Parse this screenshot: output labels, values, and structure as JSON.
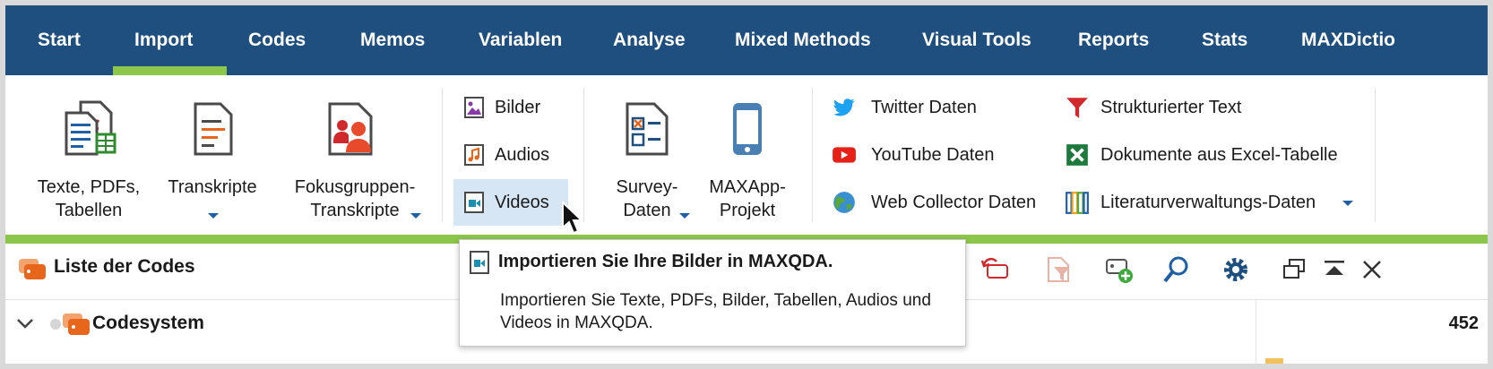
{
  "tabs": [
    {
      "label": "Start",
      "active": false
    },
    {
      "label": "Import",
      "active": true
    },
    {
      "label": "Codes",
      "active": false
    },
    {
      "label": "Memos",
      "active": false
    },
    {
      "label": "Variablen",
      "active": false
    },
    {
      "label": "Analyse",
      "active": false
    },
    {
      "label": "Mixed Methods",
      "active": false
    },
    {
      "label": "Visual Tools",
      "active": false
    },
    {
      "label": "Reports",
      "active": false
    },
    {
      "label": "Stats",
      "active": false
    },
    {
      "label": "MAXDictio",
      "active": false
    }
  ],
  "ribbon": {
    "texte": {
      "line1": "Texte, PDFs,",
      "line2": "Tabellen"
    },
    "transkripte": {
      "label": "Transkripte"
    },
    "fokusgruppen": {
      "line1": "Fokusgruppen-",
      "line2": "Transkripte"
    },
    "media": {
      "bilder": "Bilder",
      "audios": "Audios",
      "videos": "Videos"
    },
    "survey": {
      "line1": "Survey-",
      "line2": "Daten"
    },
    "maxapp": {
      "line1": "MAXApp-",
      "line2": "Projekt"
    },
    "web": {
      "twitter": "Twitter Daten",
      "youtube": "YouTube Daten",
      "webcollector": "Web Collector Daten"
    },
    "other": {
      "strukturiert": "Strukturierter Text",
      "excel": "Dokumente aus Excel-Tabelle",
      "literatur": "Literaturverwaltungs-Daten"
    }
  },
  "tooltip": {
    "title": "Importieren Sie Ihre Bilder in MAXQDA.",
    "body": "Importieren Sie Texte, PDFs, Bilder, Tabellen, Audios und Videos in MAXQDA."
  },
  "panel": {
    "title": "Liste der Codes",
    "root_label": "Codesystem",
    "root_count": "452"
  },
  "colors": {
    "tabbar": "#1e4f7e",
    "accent_green": "#8cc64a",
    "code_orange": "#e8661c",
    "icon_blue": "#1e5fa6"
  }
}
